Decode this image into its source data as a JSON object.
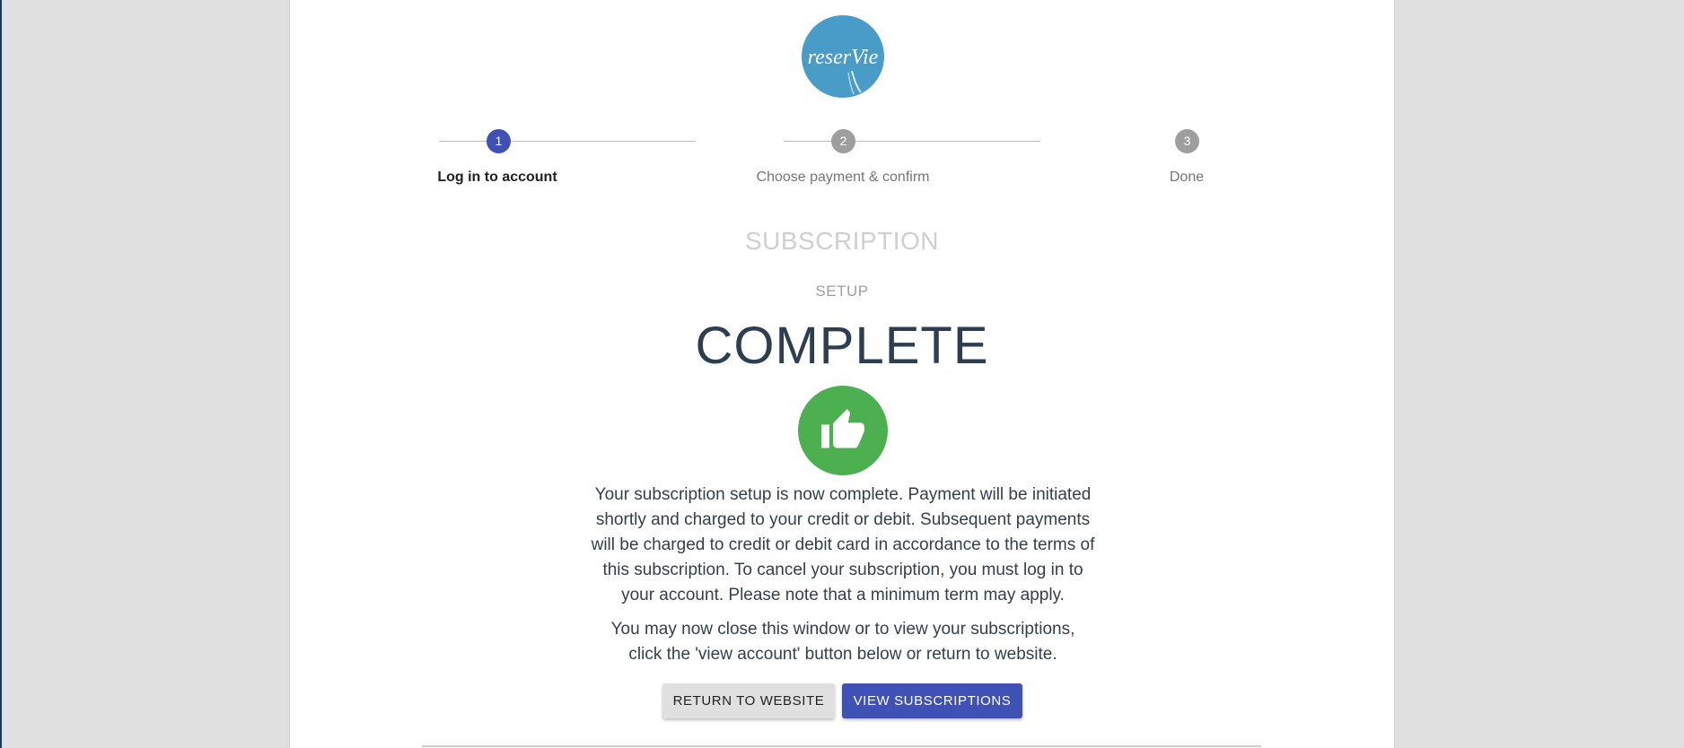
{
  "colors": {
    "accent": "#3f51b5",
    "step_inactive": "#9e9e9e",
    "success": "#4caf50",
    "logo_blue": "#4a9cc8"
  },
  "logo": {
    "text": "reserVie",
    "icon": "reservie-logo"
  },
  "stepper": {
    "steps": [
      {
        "number": "1",
        "label": "Log in to account",
        "active": true
      },
      {
        "number": "2",
        "label": "Choose payment & confirm",
        "active": false
      },
      {
        "number": "3",
        "label": "Done",
        "active": false
      }
    ]
  },
  "heading": {
    "subscription": "SUBSCRIPTION",
    "setup": "SETUP",
    "complete": "COMPLETE"
  },
  "status_icon": "thumbs-up-icon",
  "messages": {
    "complete_text": "Your subscription setup is now complete. Payment will be initiated shortly and charged to your credit or debit. Subsequent payments will be charged to credit or debit card in accordance to the terms of this subscription. To cancel your subscription, you must log in to your account. Please note that a minimum term may apply.",
    "close_text": "You may now close this window or to view your subscriptions, click the 'view account' button below or return to website."
  },
  "buttons": {
    "return_label": "RETURN TO WEBSITE",
    "view_label": "VIEW SUBSCRIPTIONS"
  }
}
